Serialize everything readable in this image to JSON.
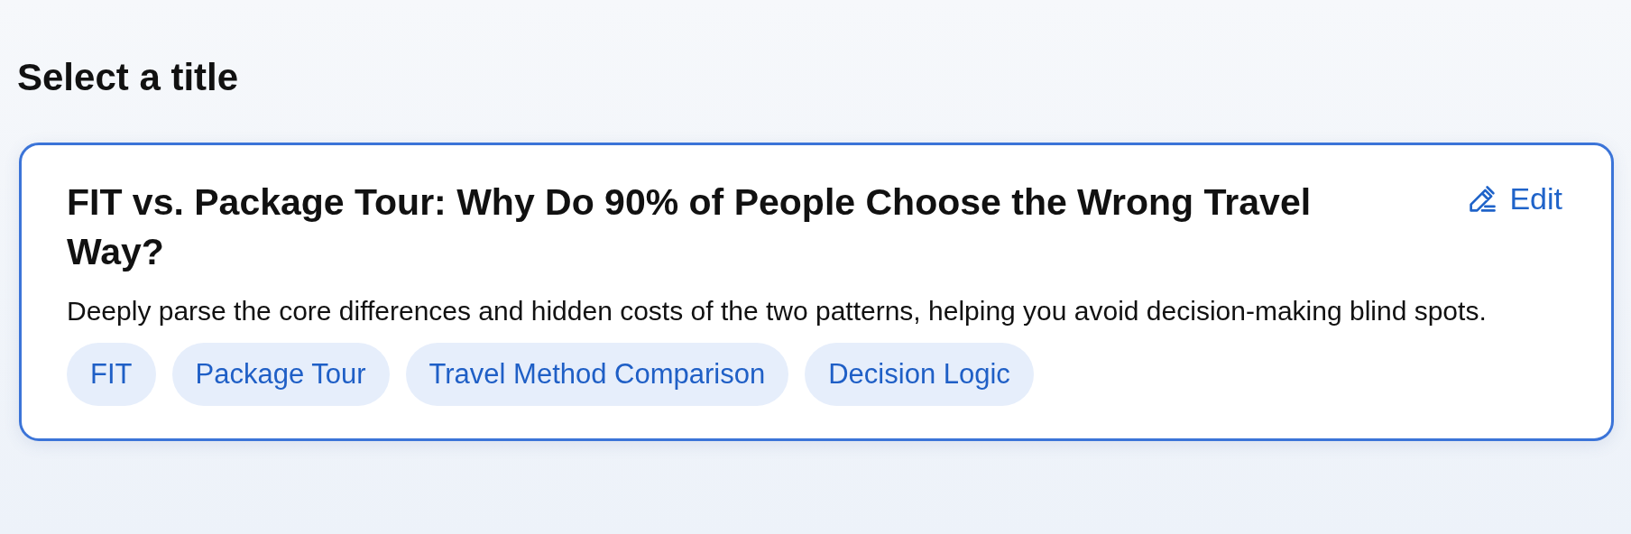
{
  "heading": "Select a title",
  "options": [
    {
      "selected": true,
      "title": "FIT vs. Package Tour: Why Do 90% of People Choose the Wrong Travel Way?",
      "edit_label": "Edit",
      "description": "Deeply parse the core differences and hidden costs of the two patterns, helping you avoid decision-making blind spots.",
      "tags": [
        "FIT",
        "Package Tour",
        "Travel Method Comparison",
        "Decision Logic"
      ]
    }
  ]
}
